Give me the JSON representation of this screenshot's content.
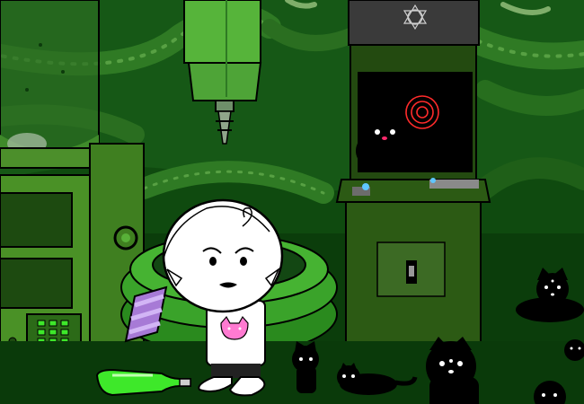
{
  "scene": {
    "palette": {
      "wall_dark": "#0b3d0b",
      "wall_mid": "#1f6a1a",
      "pipe": "#2f7a24",
      "pipe_light": "#57a043",
      "floor": "#0a3a0a",
      "machine_body": "#3f7f20",
      "machine_light": "#6fb03c",
      "arcade_body": "#2c5a14",
      "screen": "#000000",
      "cat": "#000000",
      "cat_nose": "#ff2a6d",
      "scarf_purple": "#a77ad6",
      "scarf_light": "#c9a7f0",
      "bottle_green": "#3ee82a",
      "ring_red": "#ff2b2b",
      "character_skin": "#ffffff",
      "character_outline": "#000000"
    },
    "icons": [
      "spirograph-logo-icon",
      "cat-shirt-icon"
    ]
  }
}
